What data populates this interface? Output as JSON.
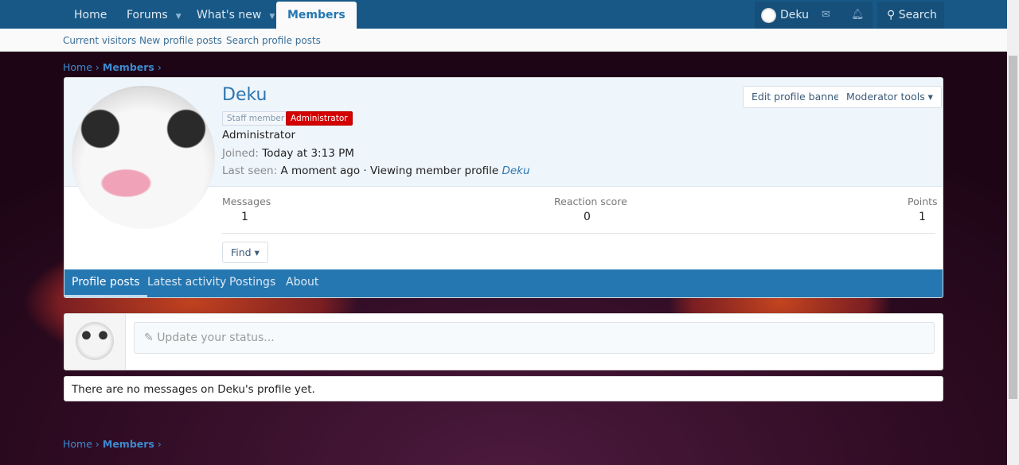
{
  "nav": {
    "items": [
      {
        "label": "Home"
      },
      {
        "label": "Forums"
      },
      {
        "label": "What's new"
      },
      {
        "label": "Members"
      }
    ],
    "user": "Deku",
    "search": "Search"
  },
  "subnav": [
    "Current visitors",
    "New profile posts",
    "Search profile posts"
  ],
  "breadcrumb": {
    "home": "Home",
    "members": "Members",
    "sep": "›"
  },
  "profile": {
    "name": "Deku",
    "badges": [
      "Staff member",
      "Administrator"
    ],
    "title": "Administrator",
    "joined_label": "Joined:",
    "joined": "Today at 3:13 PM",
    "last_seen_label": "Last seen:",
    "last_seen": "A moment ago · Viewing member profile",
    "last_seen_link": "Deku",
    "buttons": {
      "edit_banner": "Edit profile banner",
      "mod_tools": "Moderator tools ▾"
    },
    "stats": [
      {
        "label": "Messages",
        "value": "1"
      },
      {
        "label": "Reaction score",
        "value": "0"
      },
      {
        "label": "Points",
        "value": "1"
      }
    ],
    "find": "Find ▾",
    "tabs": [
      "Profile posts",
      "Latest activity",
      "Postings",
      "About"
    ]
  },
  "status": {
    "placeholder": "Update your status..."
  },
  "empty": "There are no messages on Deku's profile yet.",
  "colors": {
    "nav": "#185886",
    "accent": "#2577b1",
    "admin_badge": "#d40000"
  }
}
